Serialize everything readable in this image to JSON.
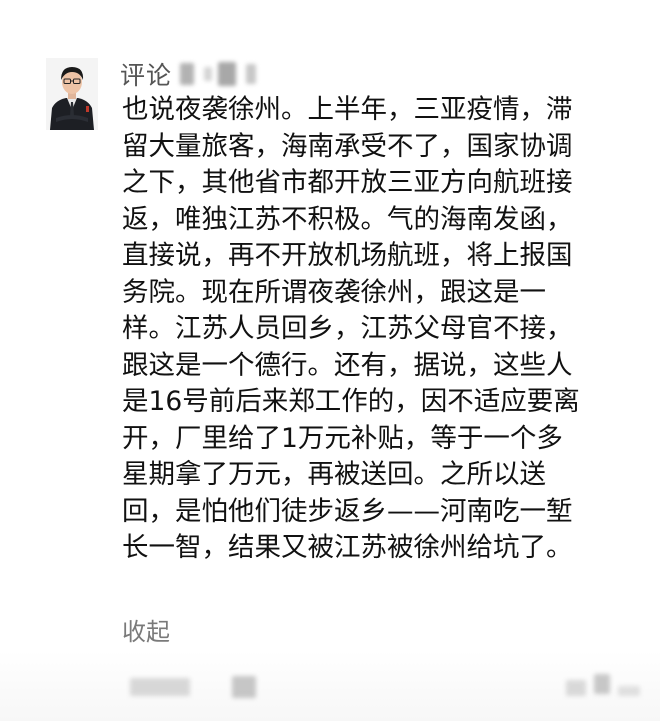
{
  "comment": {
    "author_label": "评论",
    "lines": [
      "也说夜袭徐州。上半年，三亚疫情，滞",
      "留大量旅客，海南承受不了，国家协调",
      "之下，其他省市都开放三亚方向航班接",
      "返，唯独江苏不积极。气的海南发函，",
      "直接说，再不开放机场航班，将上报国",
      "务院。现在所谓夜袭徐州，跟这是一",
      "样。江苏人员回乡，江苏父母官不接，",
      "跟这是一个德行。还有，据说，这些人",
      "是16号前后来郑工作的，因不适应要离",
      "开，厂里给了1万元补贴，等于一个多",
      "星期拿了万元，再被送回。之所以送",
      "回，是怕他们徒步返乡——河南吃一堑",
      "长一智，结果又被江苏被徐州给坑了。"
    ],
    "collapse_label": "收起"
  },
  "icons": {
    "avatar": "user-avatar-photo"
  }
}
